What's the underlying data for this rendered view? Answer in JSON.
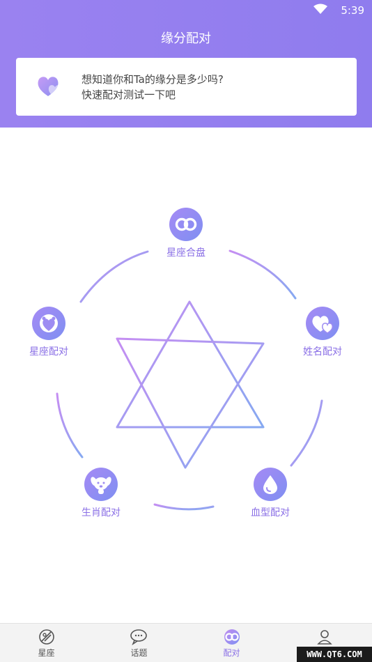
{
  "status_bar": {
    "time": "5:39"
  },
  "header": {
    "title": "缘分配对"
  },
  "intro": {
    "line1": "想知道你和Ta的缘分是多少吗?",
    "line2": "快速配对测试一下吧"
  },
  "nodes": [
    {
      "label": "星座合盘",
      "icon": "co-rings-icon"
    },
    {
      "label": "姓名配对",
      "icon": "hearts-icon"
    },
    {
      "label": "血型配对",
      "icon": "drop-icon"
    },
    {
      "label": "生肖配对",
      "icon": "dog-icon"
    },
    {
      "label": "星座配对",
      "icon": "heart-face-icon"
    }
  ],
  "tabs": [
    {
      "label": "星座",
      "icon": "zodiac-icon",
      "active": false
    },
    {
      "label": "话题",
      "icon": "chat-icon",
      "active": false
    },
    {
      "label": "配对",
      "icon": "co-rings-icon",
      "active": true
    },
    {
      "label": "",
      "icon": "user-icon",
      "active": false
    }
  ],
  "watermark": "WWW.QT6.COM",
  "colors": {
    "accent": "#9180ee",
    "label": "#8a6fe6",
    "gradient_pink": "#c08ef0",
    "gradient_blue": "#8eaaf2"
  }
}
